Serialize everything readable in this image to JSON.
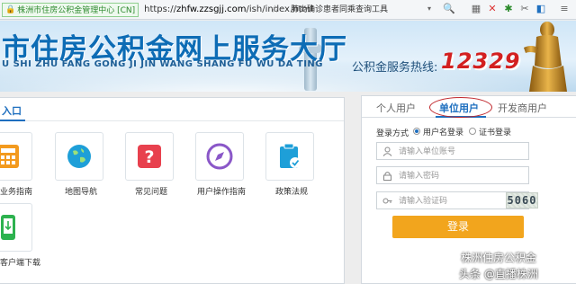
{
  "browser": {
    "site_badge": "株洲市住房公积金管理中心 [CN]",
    "url_prefix": "https://",
    "url_domain": "zhfw.zzsgjj.com",
    "url_path": "/ish/index.html",
    "news_ticker": "肺炎确诊患者同乘查询工具"
  },
  "banner": {
    "title": "市住房公积金网上服务大厅",
    "pinyin": "U SHI ZHU FANG GONG JI JIN WANG SHANG FU WU DA TING",
    "hotline_label": "公积金服务热线:",
    "hotline_number": "12329"
  },
  "left_panel": {
    "heading": "入口",
    "tiles": [
      {
        "label": "业务指南",
        "icon": "calculator-icon",
        "color": "#f39a1e"
      },
      {
        "label": "地图导航",
        "icon": "globe-icon",
        "color": "#1e9fd8"
      },
      {
        "label": "常见问题",
        "icon": "question-icon",
        "color": "#e8414e"
      },
      {
        "label": "用户操作指南",
        "icon": "compass-icon",
        "color": "#8a57c8"
      },
      {
        "label": "政策法规",
        "icon": "clipboard-check-icon",
        "color": "#1e9fd8"
      },
      {
        "label": "客户端下载",
        "icon": "mobile-icon",
        "color": "#2db24f"
      }
    ]
  },
  "login": {
    "tabs": [
      "个人用户",
      "单位用户",
      "开发商用户"
    ],
    "active_tab": "单位用户",
    "mode_label": "登录方式",
    "modes": [
      "用户名登录",
      "证书登录"
    ],
    "selected_mode": "用户名登录",
    "account_placeholder": "请输入单位账号",
    "password_placeholder": "请输入密码",
    "captcha_placeholder": "请输入验证码",
    "captcha_code": "5060",
    "submit_label": "登录"
  },
  "watermark": {
    "line1": "株洲住房公积金",
    "line2": "头条 @直播株洲"
  },
  "colors": {
    "brand_blue": "#0d6cb5",
    "hotline_red": "#d32020",
    "login_button": "#f2a51d",
    "annotation_red": "#c0262b"
  }
}
